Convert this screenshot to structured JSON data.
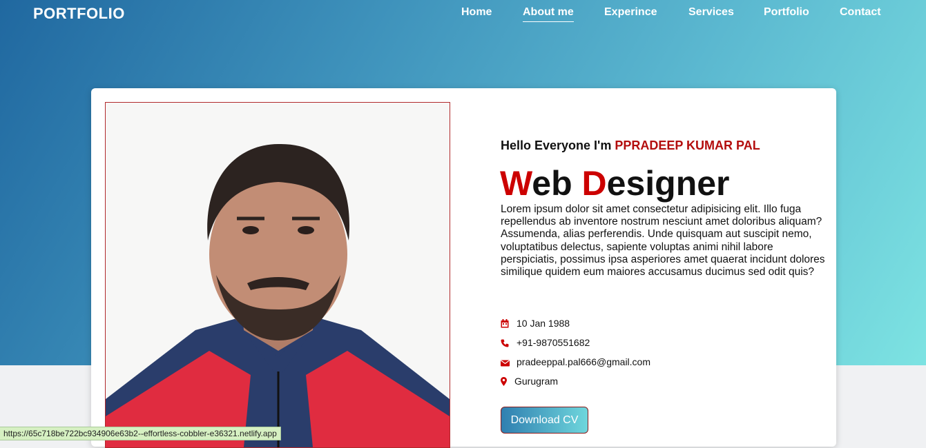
{
  "header": {
    "brand": "PORTFOLIO"
  },
  "nav": {
    "items": [
      "Home",
      "About me",
      "Experince",
      "Services",
      "Portfolio",
      "Contact"
    ],
    "active": "About me"
  },
  "about": {
    "greeting_prefix": "Hello Everyone I'm ",
    "name": "PPRADEEP KUMAR PAL",
    "title_letter1": "W",
    "title_rest1": "eb ",
    "title_letter2": "D",
    "title_rest2": "esigner",
    "bio": "Lorem ipsum dolor sit amet consectetur adipisicing elit. Illo fuga repellendus ab inventore nostrum nesciunt amet doloribus aliquam? Assumenda, alias perferendis. Unde quisquam aut suscipit nemo, voluptatibus delectus, sapiente voluptas animi nihil labore perspiciatis, possimus ipsa asperiores amet quaerat incidunt dolores similique quidem eum maiores accusamus ducimus sed odit quis?",
    "info": [
      {
        "icon": "calendar-icon",
        "text": "10 Jan 1988"
      },
      {
        "icon": "phone-icon",
        "text": "+91-9870551682"
      },
      {
        "icon": "envelope-icon",
        "text": "pradeeppal.pal666@gmail.com"
      },
      {
        "icon": "map-marker-icon",
        "text": "Gurugram"
      }
    ],
    "button": "Download CV"
  },
  "status_bar": {
    "url": "https://65c718be722bc934906e63b2--effortless-cobbler-e36321.netlify.app"
  },
  "colors": {
    "accent": "#c00000",
    "gradient_start": "#2068a0",
    "gradient_end": "#7de3e2"
  }
}
